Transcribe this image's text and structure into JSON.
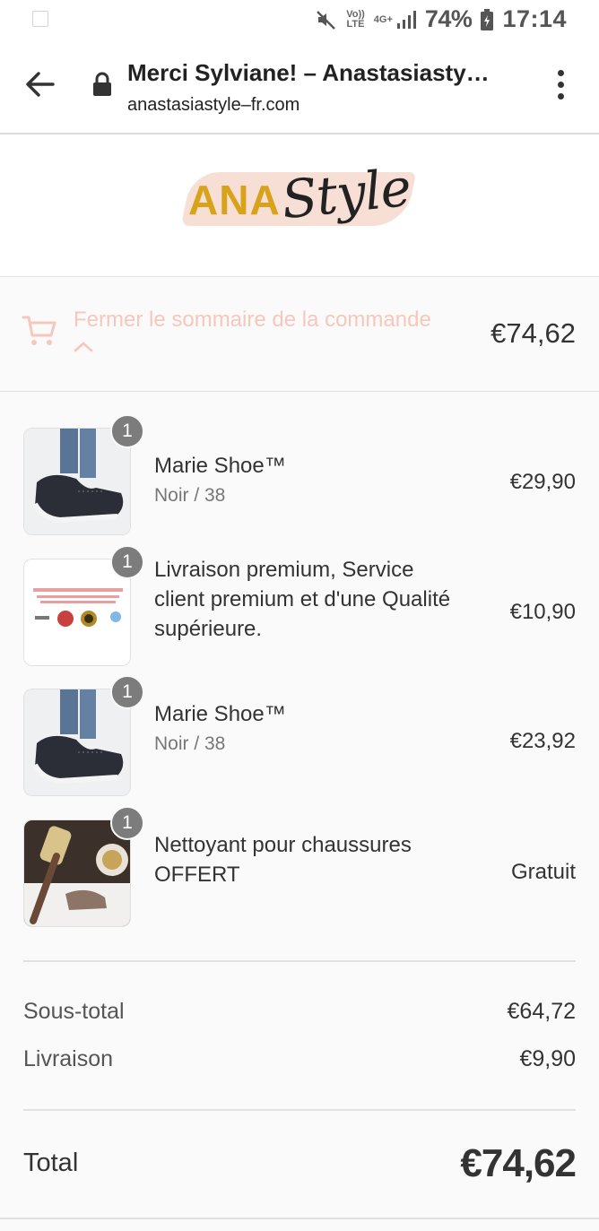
{
  "status_bar": {
    "network_label_top": "Vo))",
    "network_label_bottom": "LTE",
    "network_type": "4G+",
    "battery": "74%",
    "time": "17:14"
  },
  "browser": {
    "title": "Merci Sylviane! – Anastasiasty…",
    "url": "anastasiastyle–fr.com"
  },
  "logo": {
    "ana": "ANA",
    "style": "Style"
  },
  "summary": {
    "toggle_label": "Fermer le sommaire de la commande",
    "total": "€74,62",
    "accent_color": "#f7c7bc"
  },
  "items": [
    {
      "quantity": "1",
      "name": "Marie Shoe™",
      "variant": "Noir / 38",
      "price": "€29,90",
      "image": "black-sneaker"
    },
    {
      "quantity": "1",
      "name": "Livraison premium, Service client premium et d'une Qualité supérieure.",
      "variant": "",
      "price": "€10,90",
      "image": "premium-badges"
    },
    {
      "quantity": "1",
      "name": "Marie Shoe™",
      "variant": "Noir / 38",
      "price": "€23,92",
      "image": "black-sneaker"
    },
    {
      "quantity": "1",
      "name": "Nettoyant pour chaussures OFFERT",
      "variant": "",
      "price": "Gratuit",
      "image": "shoe-brush"
    }
  ],
  "totals": {
    "subtotal_label": "Sous-total",
    "subtotal": "€64,72",
    "shipping_label": "Livraison",
    "shipping": "€9,90",
    "total_label": "Total",
    "total": "€74,62"
  }
}
